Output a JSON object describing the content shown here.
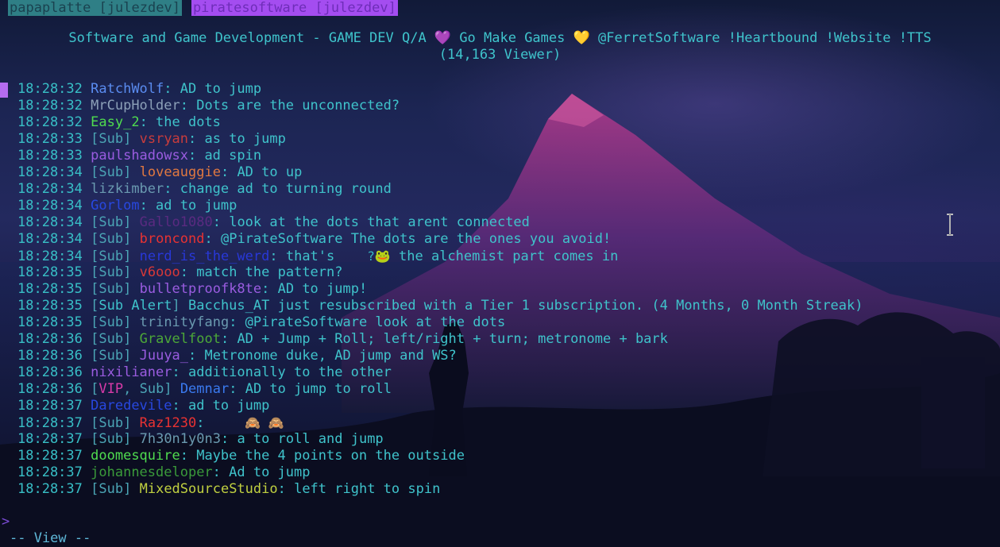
{
  "tabs": [
    {
      "label": "papaplatte [julezdev]",
      "active": false
    },
    {
      "label": "piratesoftware [julezdev]",
      "active": true
    }
  ],
  "channel": {
    "title_line1": "Software and Game Development - GAME DEV Q/A 💜 Go Make Games 💛 @FerretSoftware !Heartbound !Website !TTS",
    "title_line2": "(14,163 Viewer)"
  },
  "messages": [
    {
      "time": "18:28:32",
      "badges": [],
      "user": "RatchWolf",
      "user_color": "#5a8cf0",
      "text": ": AD to jump"
    },
    {
      "time": "18:28:32",
      "badges": [],
      "user": "MrCupHolder",
      "user_color": "#8ca0b8",
      "text": ": Dots are the unconnected?"
    },
    {
      "time": "18:28:32",
      "badges": [],
      "user": "Easy_2",
      "user_color": "#4fdc4f",
      "text": ": the dots"
    },
    {
      "time": "18:28:33",
      "badges": [
        {
          "label": "Sub",
          "color": "#4ba5b5"
        }
      ],
      "user": "vsryan",
      "user_color": "#c83c3c",
      "text": ": as to jump"
    },
    {
      "time": "18:28:33",
      "badges": [],
      "user": "paulshadowsx",
      "user_color": "#9a5ce0",
      "text": ": ad spin"
    },
    {
      "time": "18:28:34",
      "badges": [
        {
          "label": "Sub",
          "color": "#4ba5b5"
        }
      ],
      "user": "loveauggie",
      "user_color": "#e07840",
      "text": ": AD to up"
    },
    {
      "time": "18:28:34",
      "badges": [],
      "user": "lizkimber",
      "user_color": "#6a9ab0",
      "text": ": change ad to turning round"
    },
    {
      "time": "18:28:34",
      "badges": [],
      "user": "Gorlom",
      "user_color": "#2848e0",
      "text": ": ad to jump"
    },
    {
      "time": "18:28:34",
      "badges": [
        {
          "label": "Sub",
          "color": "#4ba5b5"
        }
      ],
      "user": "Gallo1080",
      "user_color": "#5a2a80",
      "text": ": look at the dots that arent connected"
    },
    {
      "time": "18:28:34",
      "badges": [
        {
          "label": "Sub",
          "color": "#4ba5b5"
        }
      ],
      "user": "broncond",
      "user_color": "#e83232",
      "text": ": @PirateSoftware The dots are the ones you avoid!"
    },
    {
      "time": "18:28:34",
      "badges": [
        {
          "label": "Sub",
          "color": "#4ba5b5"
        }
      ],
      "user": "nerd_is_the_werd",
      "user_color": "#2838d8",
      "text": ": that's",
      "emote": "?🐸",
      "text_after": " the alchemist part comes in"
    },
    {
      "time": "18:28:35",
      "badges": [
        {
          "label": "Sub",
          "color": "#4ba5b5"
        }
      ],
      "user": "v6ooo",
      "user_color": "#d83838",
      "text": ": match the pattern?"
    },
    {
      "time": "18:28:35",
      "badges": [
        {
          "label": "Sub",
          "color": "#4ba5b5"
        }
      ],
      "user": "bulletproofk8te",
      "user_color": "#9a5ce0",
      "text": ": AD to jump!"
    },
    {
      "time": "18:28:35",
      "badges": [
        {
          "label": "Sub Alert",
          "color": "#3fc3cb"
        }
      ],
      "user": "",
      "user_color": "#3fc3cb",
      "text": " Bacchus_AT just resubscribed with a Tier 1 subscription. (4 Months, 0 Month Streak)"
    },
    {
      "time": "18:28:35",
      "badges": [
        {
          "label": "Sub",
          "color": "#4ba5b5"
        }
      ],
      "user": "trinityfang",
      "user_color": "#6a9ab0",
      "text": ": @PirateSoftware look at the dots"
    },
    {
      "time": "18:28:36",
      "badges": [
        {
          "label": "Sub",
          "color": "#4ba5b5"
        }
      ],
      "user": "Gravelfoot",
      "user_color": "#4ca838",
      "text": ": AD + Jump + Roll; left/right + turn; metronome + bark"
    },
    {
      "time": "18:28:36",
      "badges": [
        {
          "label": "Sub",
          "color": "#4ba5b5"
        }
      ],
      "user": "Juuya_",
      "user_color": "#9a5ce0",
      "text": ": Metronome duke, AD jump and WS?"
    },
    {
      "time": "18:28:36",
      "badges": [],
      "user": "nixilianer",
      "user_color": "#9a5ce0",
      "text": ": additionally to the other"
    },
    {
      "time": "18:28:36",
      "badges": [
        {
          "label": "VIP",
          "color": "#d83aa8"
        },
        {
          "label": "Sub",
          "color": "#4ba5b5"
        }
      ],
      "user": "Demnar",
      "user_color": "#3a7af0",
      "text": ": AD to jump to roll"
    },
    {
      "time": "18:28:37",
      "badges": [],
      "user": "Daredevile",
      "user_color": "#2848e0",
      "text": ": ad to jump"
    },
    {
      "time": "18:28:37",
      "badges": [
        {
          "label": "Sub",
          "color": "#4ba5b5"
        }
      ],
      "user": "Raz1230",
      "user_color": "#e83232",
      "text": ":",
      "emote": " 🙈 🙈",
      "text_after": ""
    },
    {
      "time": "18:28:37",
      "badges": [
        {
          "label": "Sub",
          "color": "#4ba5b5"
        }
      ],
      "user": "7h30n1y0n3",
      "user_color": "#6a9ab0",
      "text": ": a to roll and jump"
    },
    {
      "time": "18:28:37",
      "badges": [],
      "user": "doomesquire",
      "user_color": "#4fdc4f",
      "text": ": Maybe the 4 points on the outside"
    },
    {
      "time": "18:28:37",
      "badges": [],
      "user": "johannesdeloper",
      "user_color": "#3a9a3a",
      "text": ": Ad to jump"
    },
    {
      "time": "18:28:37",
      "badges": [
        {
          "label": "Sub",
          "color": "#4ba5b5"
        }
      ],
      "user": "MixedSourceStudio",
      "user_color": "#c0d040",
      "text": ": left right to spin"
    }
  ],
  "input": {
    "prompt": ">",
    "value": ""
  },
  "status": {
    "mode": "-- View --"
  }
}
